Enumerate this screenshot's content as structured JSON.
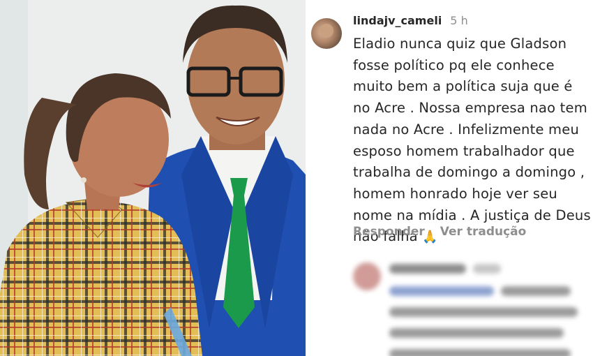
{
  "comment": {
    "username": "lindajv_cameli",
    "timestamp": "5 h",
    "text_lines": [
      "Eladio nunca quiz que Gladson",
      "fosse político pq ele conhece",
      "muito bem a política suja que é",
      "no Acre . Nossa empresa nao tem",
      "nada no Acre . Infelizmente meu",
      "esposo homem trabalhador que",
      "trabalha de domingo a domingo ,",
      "homem honrado hoje ver seu",
      "nome na mídia . A justiça de Deus",
      "não falha"
    ],
    "emoji": "🙏",
    "reply_label": "Responder",
    "translate_label": "Ver tradução"
  },
  "colors": {
    "username": "#262626",
    "meta": "#8e8e8e",
    "suit": "#1f4fb0",
    "tie": "#1a9a4a",
    "shirt_plaid": "#e6c35a"
  }
}
